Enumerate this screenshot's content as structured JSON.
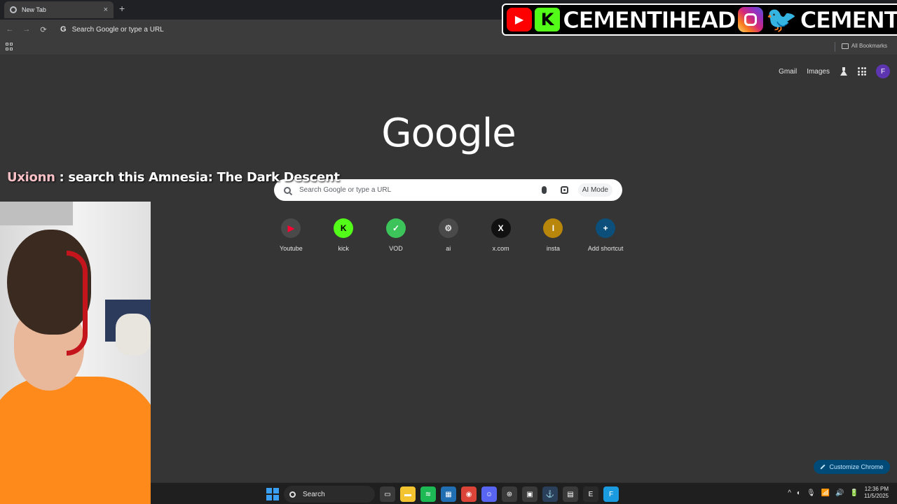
{
  "browser": {
    "tab_title": "New Tab",
    "tab_close": "×",
    "new_tab": "+",
    "omnibox_placeholder": "Search Google or type a URL",
    "omnibox_g": "G",
    "all_bookmarks": "All Bookmarks",
    "nav": {
      "back": "←",
      "forward": "→",
      "reload": "⟳"
    }
  },
  "overlay": {
    "social_handle_1": "CEMENTIHEAD",
    "social_handle_2": "CEMENTIII",
    "youtube_glyph": "▶",
    "kick_glyph": "K",
    "twitter_glyph": "🐦",
    "chat_user": "Uxionn",
    "chat_message": " : search this Amnesia: The Dark Descent"
  },
  "google": {
    "logo": "Google",
    "gmail": "Gmail",
    "images": "Images",
    "avatar_letter": "F",
    "search_placeholder": "Search Google or type a URL",
    "ai_mode": "AI Mode",
    "shortcuts": [
      {
        "label": "Youtube",
        "glyph": "▶",
        "color": "#ff0033",
        "bg": "#4a4a4a"
      },
      {
        "label": "kick",
        "glyph": "K",
        "color": "#000000",
        "bg": "#53fc18"
      },
      {
        "label": "VOD",
        "glyph": "✓",
        "color": "#ffffff",
        "bg": "#3cc45b"
      },
      {
        "label": "ai",
        "glyph": "⚙",
        "color": "#e3e3e3",
        "bg": "#4a4a4a"
      },
      {
        "label": "x.com",
        "glyph": "X",
        "color": "#ffffff",
        "bg": "#111111"
      },
      {
        "label": "insta",
        "glyph": "I",
        "color": "#ffffff",
        "bg": "#b8860b"
      },
      {
        "label": "Add shortcut",
        "glyph": "+",
        "color": "#ffffff",
        "bg": "#0b4f7a"
      }
    ],
    "customize": "Customize Chrome"
  },
  "taskbar": {
    "search_label": "Search",
    "time": "12:36 PM",
    "date": "11/5/2025",
    "apps": [
      {
        "name": "task-view",
        "glyph": "▭",
        "bg": "#3a3a3a"
      },
      {
        "name": "file-explorer",
        "glyph": "▬",
        "bg": "#f4c430"
      },
      {
        "name": "spotify",
        "glyph": "≋",
        "bg": "#1db954"
      },
      {
        "name": "photos",
        "glyph": "▦",
        "bg": "#1f6fb2"
      },
      {
        "name": "chrome",
        "glyph": "◉",
        "bg": "#db4437"
      },
      {
        "name": "discord",
        "glyph": "☺",
        "bg": "#5865f2"
      },
      {
        "name": "xbox",
        "glyph": "⊛",
        "bg": "#3a3a3a"
      },
      {
        "name": "app-grid",
        "glyph": "▣",
        "bg": "#3a3a3a"
      },
      {
        "name": "steam",
        "glyph": "⚓",
        "bg": "#2a3f5a"
      },
      {
        "name": "calculator",
        "glyph": "▤",
        "bg": "#3a3a3a"
      },
      {
        "name": "epic",
        "glyph": "E",
        "bg": "#2a2a2a"
      },
      {
        "name": "app-f",
        "glyph": "F",
        "bg": "#1a9be0"
      }
    ],
    "tray_glyphs": [
      "^",
      "◐",
      "🎙",
      "📶",
      "🔊",
      "🔋"
    ]
  }
}
